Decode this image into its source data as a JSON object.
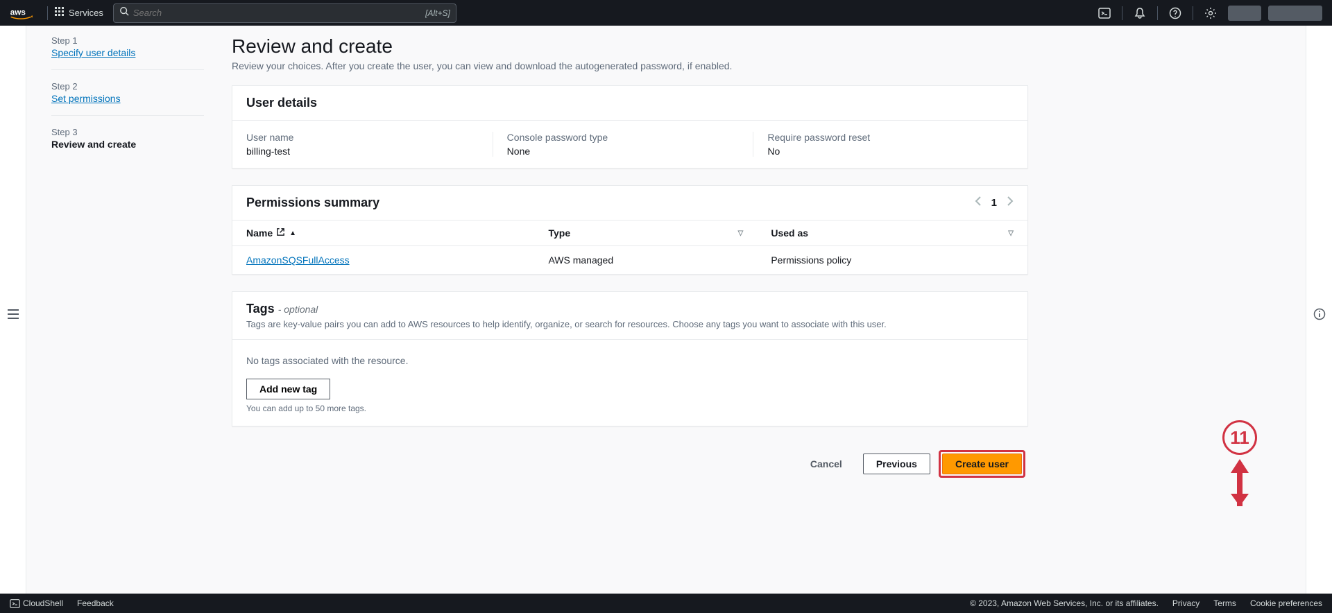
{
  "nav": {
    "services_label": "Services",
    "search_placeholder": "Search",
    "search_shortcut": "[Alt+S]"
  },
  "steps": [
    {
      "label": "Step 1",
      "title": "Specify user details",
      "link": true
    },
    {
      "label": "Step 2",
      "title": "Set permissions",
      "link": true
    },
    {
      "label": "Step 3",
      "title": "Review and create",
      "link": false
    }
  ],
  "page": {
    "title": "Review and create",
    "description": "Review your choices. After you create the user, you can view and download the autogenerated password, if enabled."
  },
  "user_details": {
    "heading": "User details",
    "fields": [
      {
        "label": "User name",
        "value": "billing-test"
      },
      {
        "label": "Console password type",
        "value": "None"
      },
      {
        "label": "Require password reset",
        "value": "No"
      }
    ]
  },
  "permissions": {
    "heading": "Permissions summary",
    "page_number": "1",
    "columns": {
      "name": "Name",
      "type": "Type",
      "used_as": "Used as"
    },
    "rows": [
      {
        "name": "AmazonSQSFullAccess",
        "type": "AWS managed",
        "used_as": "Permissions policy"
      }
    ]
  },
  "tags": {
    "heading": "Tags",
    "optional": "- optional",
    "description": "Tags are key-value pairs you can add to AWS resources to help identify, organize, or search for resources. Choose any tags you want to associate with this user.",
    "none_text": "No tags associated with the resource.",
    "add_button": "Add new tag",
    "limit_text": "You can add up to 50 more tags."
  },
  "actions": {
    "cancel": "Cancel",
    "previous": "Previous",
    "create": "Create user"
  },
  "annotation": {
    "number": "11"
  },
  "footer": {
    "cloudshell": "CloudShell",
    "feedback": "Feedback",
    "copyright": "© 2023, Amazon Web Services, Inc. or its affiliates.",
    "privacy": "Privacy",
    "terms": "Terms",
    "cookie": "Cookie preferences"
  }
}
